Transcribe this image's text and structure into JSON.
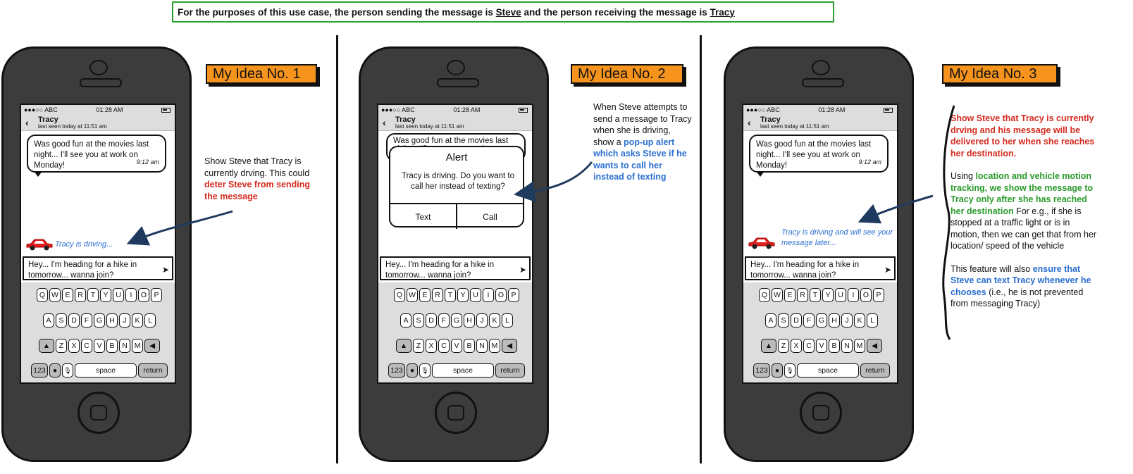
{
  "header": {
    "prefix": "For the purposes of this use case, the person sending the message is ",
    "sender": "Steve",
    "middle": " and the person receiving the message is ",
    "receiver": "Tracy"
  },
  "phone": {
    "status_signal": "●●●○○ ABC",
    "status_time": "01:28 AM",
    "contact_name": "Tracy",
    "last_seen": "last seen today at 11:51 am",
    "received_message": "Was good fun at the movies last night... I'll see you at work on Monday!",
    "received_time": "9:12 am",
    "draft_message": "Hey... I'm heading for a hike in tomorrow... wanna join?",
    "keys_row1": [
      "Q",
      "W",
      "E",
      "R",
      "T",
      "Y",
      "U",
      "I",
      "O",
      "P"
    ],
    "keys_row2": [
      "A",
      "S",
      "D",
      "F",
      "G",
      "H",
      "J",
      "K",
      "L"
    ],
    "keys_row3": [
      "Z",
      "X",
      "C",
      "V",
      "B",
      "N",
      "M"
    ],
    "key_123": "123",
    "key_space": "space",
    "key_return": "return"
  },
  "idea1": {
    "label": "My Idea No. 1",
    "driving_text": "Tracy is driving...",
    "note_plain": "Show Steve that Tracy is currently drving. This could ",
    "note_red": "deter Steve from sending the message"
  },
  "idea2": {
    "label": "My Idea No. 2",
    "alert_title": "Alert",
    "alert_message": "Tracy is driving. Do you want to call her instead of texting?",
    "alert_text_button": "Text",
    "alert_call_button": "Call",
    "note_plain": "When Steve attempts to send a message to Tracy when she is driving, show a ",
    "note_blue": "pop-up alert which asks Steve if he wants to call her instead of texting"
  },
  "idea3": {
    "label": "My Idea No. 3",
    "driving_text": "Tracy is driving and will see your message later...",
    "note_red": "Show Steve that Tracy is currently drving and his message will be delivered to her when she reaches her destination.",
    "note2_plain1": "Using ",
    "note2_green": "location and vehicle motion tracking, we show the message to Tracy only after she has reached her destination",
    "note2_plain2": " For e.g., if she is stopped at a traffic light or is in motion, then we can get that from her location/ speed of the vehicle",
    "note3_plain1": "This feature will also ",
    "note3_blue": "ensure that Steve can text Tracy whenever he chooses",
    "note3_plain2": " (i.e., he is not prevented from messaging Tracy)"
  },
  "colors": {
    "label_orange": "#f7941d",
    "header_border_green": "#2ea02e",
    "note_red": "#d42a1e",
    "note_blue": "#2a6fd0",
    "note_green": "#2a9a2a",
    "arrow": "#1f3a5f",
    "phone_body": "#3c3c3c"
  }
}
